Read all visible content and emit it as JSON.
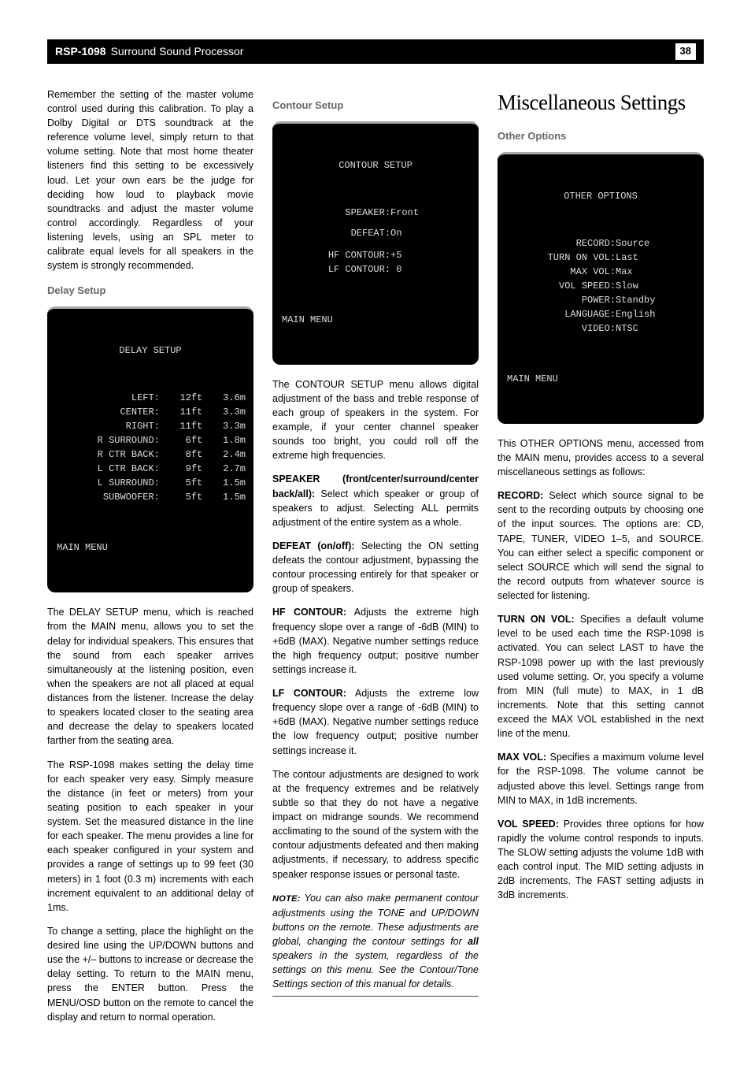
{
  "header": {
    "model": "RSP-1098",
    "sub": "Surround Sound Processor",
    "page": "38"
  },
  "col1": {
    "p1": "Remember the setting of the master volume control used during this calibration. To play a Dolby Digital or DTS soundtrack at the reference volume level, simply return to that volume setting. Note that most home theater listeners find this setting to be excessively loud. Let your own ears be the judge for deciding how loud to playback movie soundtracks and adjust the master volume control accordingly. Regardless of your listening levels, using an SPL meter to calibrate equal levels for all speakers in the system is strongly recommended.",
    "h_delay": "Delay Setup",
    "osd1": {
      "title": "DELAY SETUP",
      "rows": [
        {
          "lbl": "LEFT:",
          "ft": "12ft",
          "m": "3.6m"
        },
        {
          "lbl": "CENTER:",
          "ft": "11ft",
          "m": "3.3m"
        },
        {
          "lbl": "RIGHT:",
          "ft": "11ft",
          "m": "3.3m"
        },
        {
          "lbl": "R SURROUND:",
          "ft": "6ft",
          "m": "1.8m"
        },
        {
          "lbl": "R CTR BACK:",
          "ft": "8ft",
          "m": "2.4m"
        },
        {
          "lbl": "L CTR BACK:",
          "ft": "9ft",
          "m": "2.7m"
        },
        {
          "lbl": "L SURROUND:",
          "ft": "5ft",
          "m": "1.5m"
        },
        {
          "lbl": "SUBWOOFER:",
          "ft": "5ft",
          "m": "1.5m"
        }
      ],
      "main": "MAIN MENU"
    },
    "p2": "The DELAY SETUP menu, which is reached from the MAIN menu, allows you to set the delay for individual speakers. This ensures that the sound from each speaker arrives simultaneously at the listening position, even when the speakers are not all placed at equal distances from the listener. Increase the delay to speakers located closer to the seating area and decrease the delay to speakers located farther from the seating area.",
    "p3": "The RSP-1098 makes setting the delay time for each speaker very easy. Simply measure the distance (in feet or meters) from your seating position to each speaker in your system. Set the measured distance in the line for each speaker. The menu provides a line for each speaker configured in your system and provides a range of settings up to 99 feet (30 meters) in 1 foot (0.3 m) increments with each increment equivalent to an additional delay of 1ms.",
    "p4": "To change a setting, place the highlight on the desired line using the UP/DOWN buttons and use the +/– buttons to increase or decrease the delay setting. To return to the MAIN menu, press the ENTER button. Press the MENU/OSD button on the remote to cancel the display and return to normal operation."
  },
  "col2": {
    "h_contour": "Contour Setup",
    "osd2": {
      "title": "CONTOUR SETUP",
      "rows": [
        {
          "lbl": "SPEAKER:",
          "val": "Front"
        },
        {
          "lbl": "DEFEAT:",
          "val": "On"
        },
        {
          "lbl": "HF CONTOUR:",
          "val": "+5"
        },
        {
          "lbl": "LF CONTOUR:",
          "val": " 0"
        }
      ],
      "main": "MAIN MENU"
    },
    "p1": "The CONTOUR SETUP menu allows digital adjustment of the bass and treble response of each group of speakers in the system. For example, if your center channel speaker sounds too bright, you could roll off the extreme high frequencies.",
    "spk_b": "SPEAKER (front/center/surround/center back/all):",
    "spk_t": " Select which speaker or group of speakers to adjust. Selecting ALL permits adjustment of the entire system as a whole.",
    "def_b": "DEFEAT (on/off):",
    "def_t": " Selecting the ON setting defeats the contour adjustment, bypassing the contour processing entirely for that speaker or group of speakers.",
    "hf_b": "HF CONTOUR:",
    "hf_t": " Adjusts the extreme high frequency slope over a range of -6dB (MIN) to +6dB (MAX). Negative number settings reduce the high frequency output; positive number settings increase it.",
    "lf_b": "LF CONTOUR:",
    "lf_t": " Adjusts the extreme low frequency slope over a range of -6dB (MIN) to +6dB (MAX). Negative number settings reduce the low frequency output; positive number settings increase it.",
    "p2": "The contour adjustments are designed to work at the frequency extremes and be relatively subtle so that they do not have a negative impact on midrange sounds. We recommend acclimating to the sound of the system with the contour adjustments defeated and then making adjustments, if necessary, to address specific speaker response issues or personal taste.",
    "note_b": "NOTE:",
    "note_t1": " You can also make permanent contour adjustments using the TONE and UP/DOWN buttons on the remote. These adjustments are global, changing the contour settings for ",
    "note_all": "all",
    "note_t2": " speakers in the system, regardless of the settings on this menu. See the Contour/Tone Settings section of this manual for details."
  },
  "col3": {
    "h1": "Miscellaneous Settings",
    "h_other": "Other Options",
    "osd3": {
      "title": "OTHER OPTIONS",
      "rows": [
        {
          "lbl": "RECORD:",
          "val": "Source"
        },
        {
          "lbl": "TURN ON VOL:",
          "val": "Last"
        },
        {
          "lbl": "MAX VOL:",
          "val": "Max"
        },
        {
          "lbl": "VOL SPEED:",
          "val": "Slow"
        },
        {
          "lbl": "POWER:",
          "val": "Standby"
        },
        {
          "lbl": "LANGUAGE:",
          "val": "English"
        },
        {
          "lbl": "VIDEO:",
          "val": "NTSC"
        }
      ],
      "main": "MAIN MENU"
    },
    "p1": "This OTHER OPTIONS menu, accessed from the MAIN menu, provides access to a several miscellaneous settings as follows:",
    "rec_b": "RECORD:",
    "rec_t": " Select which source signal to be sent to the recording outputs by choosing one of the input sources. The options are: CD, TAPE, TUNER, VIDEO 1–5, and SOURCE. You can either select a specific component or select SOURCE which will send the signal to the record outputs from whatever source is selected for listening.",
    "tov_b": "TURN ON VOL:",
    "tov_t": " Specifies a default volume level to be used each time the RSP-1098 is activated. You can select LAST to have the RSP-1098 power up with the last previously used volume setting. Or, you specify a volume from MIN (full mute) to MAX, in 1 dB increments. Note that this setting cannot exceed the MAX VOL established in the next line of the menu.",
    "mv_b": "MAX VOL:",
    "mv_t": " Specifies a maximum volume level for the RSP-1098. The volume cannot be adjusted above this level. Settings range from MIN to MAX, in 1dB increments.",
    "vs_b": "VOL SPEED:",
    "vs_t": " Provides three options for how rapidly the volume control responds to inputs. The SLOW setting adjusts the volume 1dB with each control input. The MID setting adjusts in 2dB increments. The FAST setting adjusts in 3dB increments."
  }
}
